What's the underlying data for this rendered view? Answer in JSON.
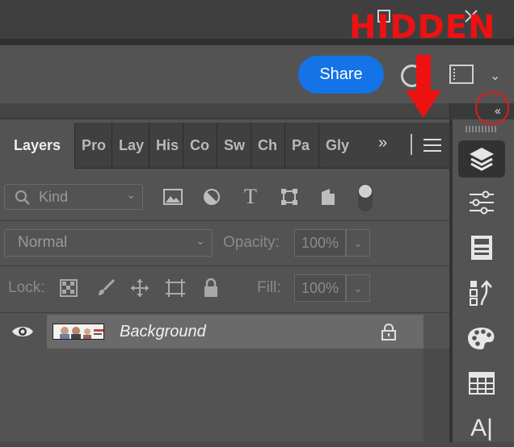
{
  "annotation": {
    "text": "HIDDEN"
  },
  "window": {
    "maximize_icon": "maximize-icon",
    "close_icon": "close-icon"
  },
  "options_bar": {
    "share_label": "Share",
    "collapse_label": "‹‹"
  },
  "panel": {
    "tabs": [
      "Layers",
      "Pro",
      "Lay",
      "His",
      "Co",
      "Sw",
      "Ch",
      "Pa",
      "Gly"
    ],
    "more_label": "»",
    "filter": {
      "kind_label": "Kind"
    },
    "blend": {
      "mode": "Normal",
      "opacity_label": "Opacity:",
      "opacity_value": "100%"
    },
    "lock": {
      "label": "Lock:",
      "fill_label": "Fill:",
      "fill_value": "100%"
    },
    "layers": [
      {
        "name": "Background",
        "visible": true,
        "locked": true
      }
    ]
  },
  "colors": {
    "accent": "#1473e6",
    "annotation": "#ee1111"
  },
  "dock_icons": [
    "layers-icon",
    "adjustments-icon",
    "properties-icon",
    "history-icon",
    "swatches-icon",
    "grid-icon",
    "character-icon"
  ]
}
